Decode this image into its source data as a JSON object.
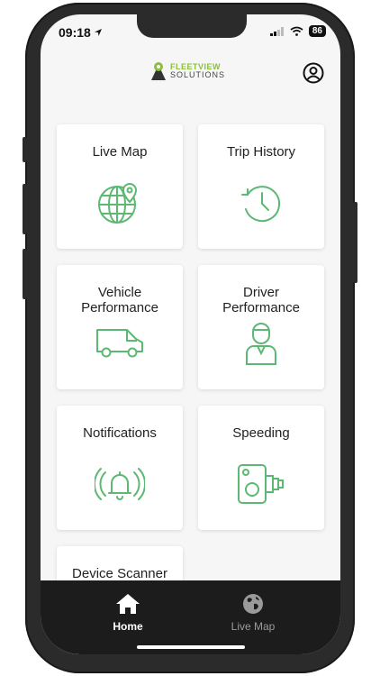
{
  "status": {
    "time": "09:18",
    "battery": "86"
  },
  "brand": {
    "line1": "FLEETVIEW",
    "line2": "SOLUTIONS"
  },
  "tiles": [
    {
      "label": "Live Map",
      "icon": "globe-pin-icon"
    },
    {
      "label": "Trip History",
      "icon": "history-clock-icon"
    },
    {
      "label": "Vehicle Performance",
      "icon": "van-icon"
    },
    {
      "label": "Driver Performance",
      "icon": "driver-icon"
    },
    {
      "label": "Notifications",
      "icon": "bell-icon"
    },
    {
      "label": "Speeding",
      "icon": "speed-camera-icon"
    },
    {
      "label": "Device Scanner",
      "icon": ""
    }
  ],
  "nav": {
    "home": "Home",
    "live_map": "Live Map"
  },
  "colors": {
    "accent": "#5cb873",
    "navbar": "#1c1c1c",
    "brand_green": "#8bbf3c"
  }
}
